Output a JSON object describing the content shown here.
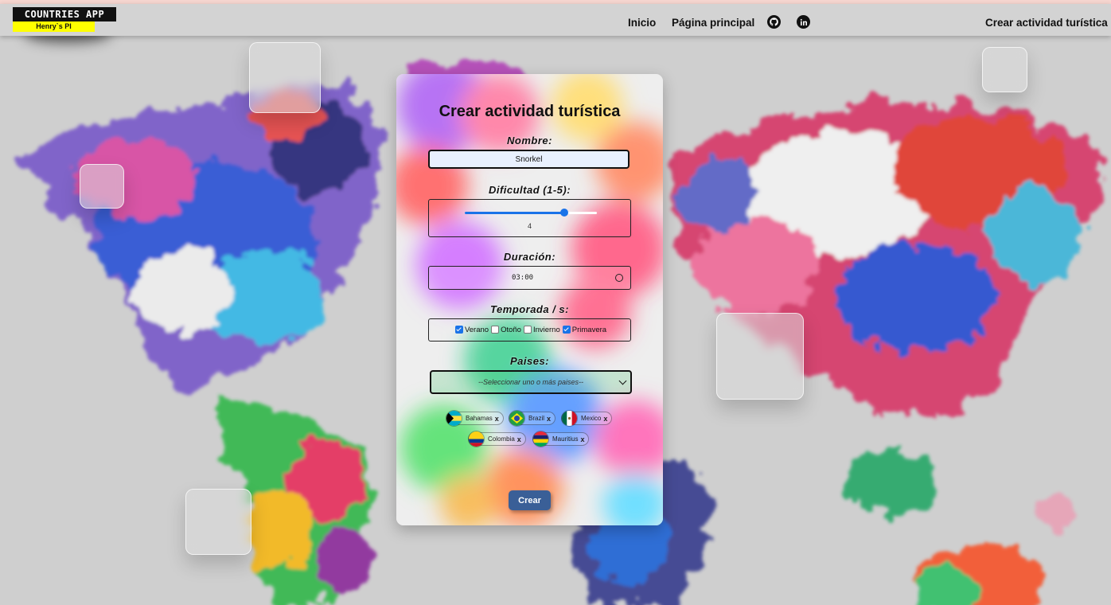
{
  "navbar": {
    "logo_title": "COUNTRIES APP",
    "logo_subtitle": "Henry`s PI",
    "links": [
      "Inicio",
      "Página principal"
    ],
    "icons": [
      "github-icon",
      "linkedin-icon"
    ],
    "right_link": "Crear actividad turística"
  },
  "form": {
    "title": "Crear actividad turística",
    "name_label": "Nombre:",
    "name_value": "Snorkel",
    "difficulty_label": "Dificultad (1-5):",
    "difficulty_value": 4,
    "difficulty_display": "4",
    "difficulty_min": 1,
    "difficulty_max": 5,
    "duration_label": "Duración:",
    "duration_value": "03:00",
    "season_label": "Temporada / s:",
    "seasons": [
      {
        "label": "Verano",
        "checked": true
      },
      {
        "label": "Otoño",
        "checked": false
      },
      {
        "label": "Invierno",
        "checked": false
      },
      {
        "label": "Primavera",
        "checked": true
      }
    ],
    "countries_label": "Paises:",
    "countries_placeholder": "--Seleccionar uno o más paises--",
    "selected_countries": [
      {
        "name": "Bahamas",
        "remove": "x"
      },
      {
        "name": "Brazil",
        "remove": "x"
      },
      {
        "name": "Mexico",
        "remove": "x"
      },
      {
        "name": "Colombia",
        "remove": "x"
      },
      {
        "name": "Mauritius",
        "remove": "x"
      }
    ],
    "submit_label": "Crear"
  },
  "colors": {
    "navbar_bg": "#d3d3d3",
    "accent": "#1a73e8",
    "button": "#3a5f97",
    "logo_yellow": "#ffff00"
  }
}
